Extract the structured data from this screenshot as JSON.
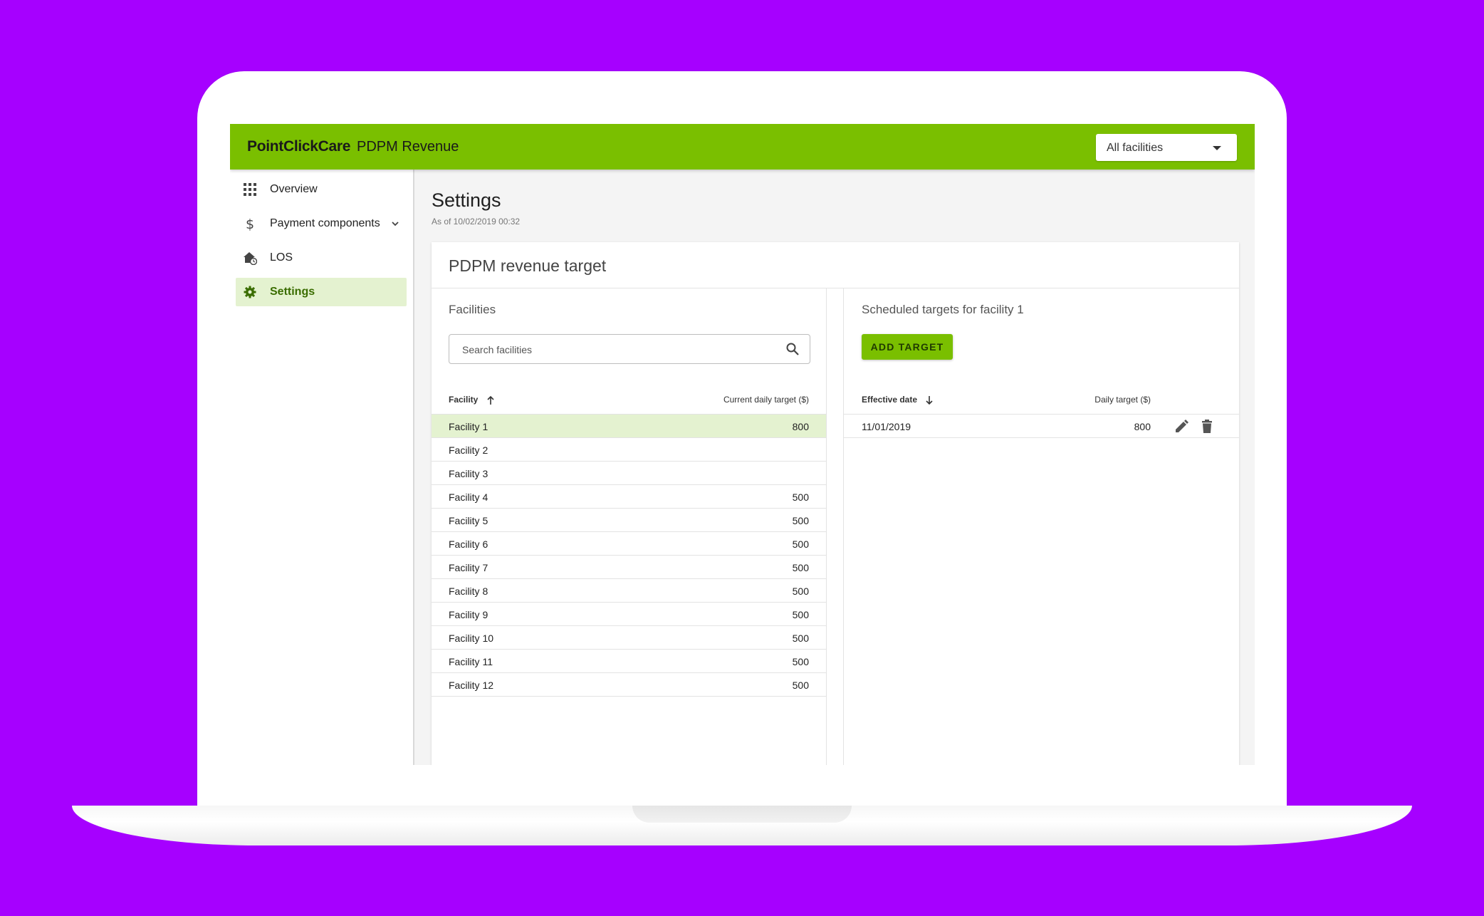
{
  "app": {
    "brand": "PointClickCare",
    "title": "PDPM Revenue",
    "facility_select": "All facilities"
  },
  "sidebar": {
    "items": [
      {
        "label": "Overview",
        "icon": "grid-icon"
      },
      {
        "label": "Payment components",
        "icon": "dollar-icon",
        "expandable": true
      },
      {
        "label": "LOS",
        "icon": "house-clock-icon"
      },
      {
        "label": "Settings",
        "icon": "gear-icon",
        "active": true
      }
    ]
  },
  "page": {
    "title": "Settings",
    "subtitle": "As of 10/02/2019 00:32"
  },
  "card": {
    "title": "PDPM revenue target",
    "facilities": {
      "section_title": "Facilities",
      "search_placeholder": "Search facilities",
      "col_facility": "Facility",
      "col_target": "Current daily target ($)",
      "rows": [
        {
          "name": "Facility 1",
          "target": "800",
          "selected": true
        },
        {
          "name": "Facility 2",
          "target": ""
        },
        {
          "name": "Facility 3",
          "target": ""
        },
        {
          "name": "Facility 4",
          "target": "500"
        },
        {
          "name": "Facility 5",
          "target": "500"
        },
        {
          "name": "Facility 6",
          "target": "500"
        },
        {
          "name": "Facility 7",
          "target": "500"
        },
        {
          "name": "Facility 8",
          "target": "500"
        },
        {
          "name": "Facility 9",
          "target": "500"
        },
        {
          "name": "Facility 10",
          "target": "500"
        },
        {
          "name": "Facility 11",
          "target": "500"
        },
        {
          "name": "Facility 12",
          "target": "500"
        }
      ]
    },
    "scheduled": {
      "section_title": "Scheduled targets for facility 1",
      "add_button": "ADD TARGET",
      "col_date": "Effective date",
      "col_target": "Daily target ($)",
      "rows": [
        {
          "date": "11/01/2019",
          "target": "800"
        }
      ]
    }
  },
  "colors": {
    "background": "#a600ff",
    "accent": "#7abf00",
    "selected_row": "#e4f2d0"
  }
}
